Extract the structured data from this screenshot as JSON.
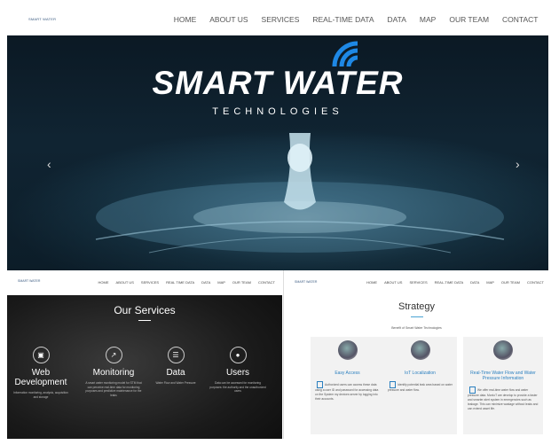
{
  "top_nav": {
    "logo": "SMART WATER",
    "links": [
      "HOME",
      "ABOUT US",
      "SERVICES",
      "REAL-TIME DATA",
      "DATA",
      "MAP",
      "OUR TEAM",
      "CONTACT"
    ]
  },
  "hero": {
    "title": "SMART WATER",
    "subtitle": "TECHNOLOGIES",
    "prev": "‹",
    "next": "›"
  },
  "services_page": {
    "logo": "SMART WATER",
    "links": [
      "HOME",
      "ABOUT US",
      "SERVICES",
      "REAL TIME DATA",
      "DATA",
      "MAP",
      "OUR TEAM",
      "CONTACT"
    ],
    "title": "Our Services",
    "items": [
      {
        "name": "Web Development",
        "desc": "Information monitoring, analysis, acquisition and storage"
      },
      {
        "name": "Monitoring",
        "desc": "A smart water monitoring model for STM that can perceive real-time data for monitoring purposes and predictive maintenance for the leaks"
      },
      {
        "name": "Data",
        "desc": "Water Flow and Water Pressure"
      },
      {
        "name": "Users",
        "desc": "Data can be accessed for monitoring purposes: the authority and the unauthorized users"
      }
    ]
  },
  "strategy_page": {
    "logo": "SMART WATER",
    "links": [
      "HOME",
      "ABOUT US",
      "SERVICES",
      "REAL-TIME DATA",
      "DATA",
      "MAP",
      "OUR TEAM",
      "CONTACT"
    ],
    "title": "Strategy",
    "subtitle": "Benefit of Smart Water Technologies",
    "cards": [
      {
        "title": "Easy Access",
        "desc": "Authorized users can access these data using a user ID and password for accessing data on the System my devices server by logging into their accounts."
      },
      {
        "title": "IoT Localization",
        "desc": "Identify potential leak area based on water pressure and water flow."
      },
      {
        "title": "Real-Time Water Flow and Water Pressure Information",
        "desc": "We offer real-time water flow and water pressure data. MonIoT are develop to provide a faster and smarter alert system in emergencies such as leakage. This can minimize wastage without leaks and can extend asset life."
      }
    ]
  }
}
